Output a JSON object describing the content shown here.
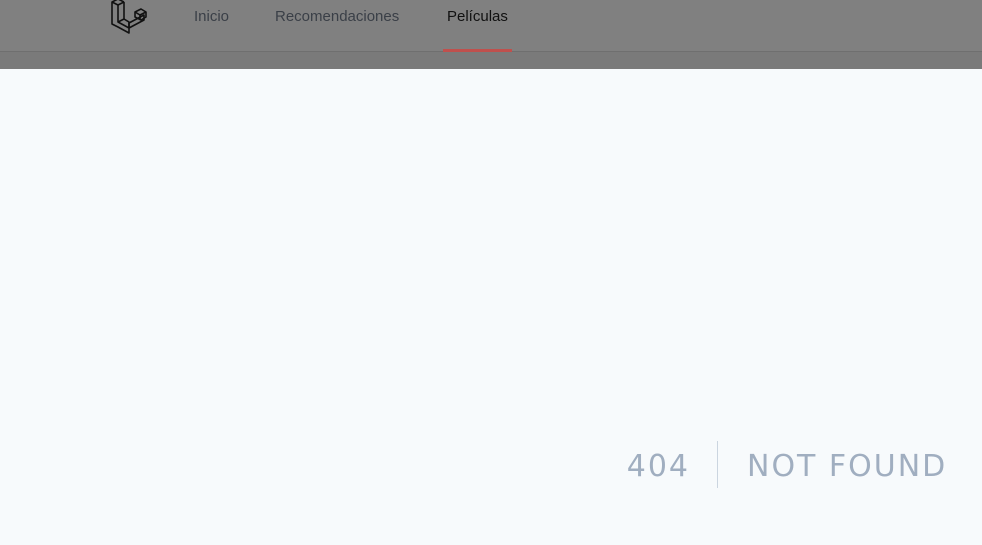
{
  "nav": {
    "logo_icon": "laravel-logo-icon",
    "links": [
      {
        "label": "Inicio",
        "active": false
      },
      {
        "label": "Recomendaciones",
        "active": false
      },
      {
        "label": "Películas",
        "active": true
      }
    ]
  },
  "error": {
    "code": "404",
    "message": "NOT FOUND"
  },
  "colors": {
    "navbar_bg": "#808080",
    "active_underline": "#c0504d",
    "error_text": "#a0aec0",
    "page_bg": "#f7fafc"
  }
}
